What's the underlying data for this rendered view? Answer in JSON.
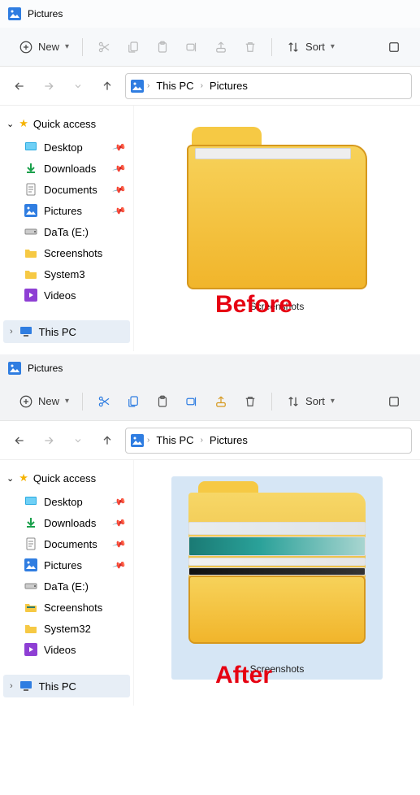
{
  "before": {
    "title": "Pictures",
    "toolbar": {
      "new_label": "New",
      "sort_label": "Sort"
    },
    "breadcrumb": {
      "root": "This PC",
      "current": "Pictures"
    },
    "sidebar": {
      "quick_access": "Quick access",
      "items": [
        {
          "label": "Desktop"
        },
        {
          "label": "Downloads"
        },
        {
          "label": "Documents"
        },
        {
          "label": "Pictures"
        },
        {
          "label": "DaTa (E:)"
        },
        {
          "label": "Screenshots"
        },
        {
          "label": "System3"
        },
        {
          "label": "Videos"
        }
      ],
      "this_pc": "This PC"
    },
    "folder_name": "Screenshots",
    "overlay": "Before"
  },
  "after": {
    "title": "Pictures",
    "toolbar": {
      "new_label": "New",
      "sort_label": "Sort"
    },
    "breadcrumb": {
      "root": "This PC",
      "current": "Pictures"
    },
    "sidebar": {
      "quick_access": "Quick access",
      "items": [
        {
          "label": "Desktop"
        },
        {
          "label": "Downloads"
        },
        {
          "label": "Documents"
        },
        {
          "label": "Pictures"
        },
        {
          "label": "DaTa (E:)"
        },
        {
          "label": "Screenshots"
        },
        {
          "label": "System32"
        },
        {
          "label": "Videos"
        }
      ],
      "this_pc": "This PC"
    },
    "folder_name": "Screenshots",
    "overlay": "After"
  }
}
